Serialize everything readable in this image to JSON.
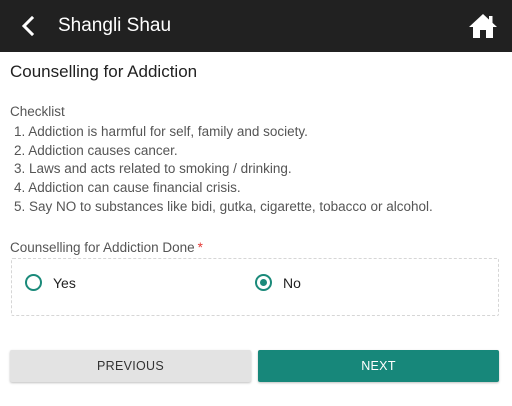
{
  "appbar": {
    "title": "Shangli Shau",
    "back_icon": "chevron-left-icon",
    "home_icon": "home-icon",
    "background": "#212121"
  },
  "page": {
    "title": "Counselling for Addiction"
  },
  "checklist": {
    "heading": "Checklist",
    "items": [
      "1. Addiction is harmful for self, family and society.",
      "2. Addiction causes cancer.",
      "3. Laws and acts related to smoking / drinking.",
      "4. Addiction can cause financial crisis.",
      "5. Say NO to substances like bidi, gutka, cigarette, tobacco or alcohol."
    ]
  },
  "counselling_field": {
    "label": "Counselling for Addiction Done",
    "required_mark": "*",
    "options": [
      {
        "label": "Yes",
        "selected": false
      },
      {
        "label": "No",
        "selected": true
      }
    ]
  },
  "buttons": {
    "previous": "PREVIOUS",
    "next": "NEXT"
  },
  "colors": {
    "accent": "#17877a",
    "required": "#e53935",
    "secondary_button": "#e3e3e3"
  }
}
